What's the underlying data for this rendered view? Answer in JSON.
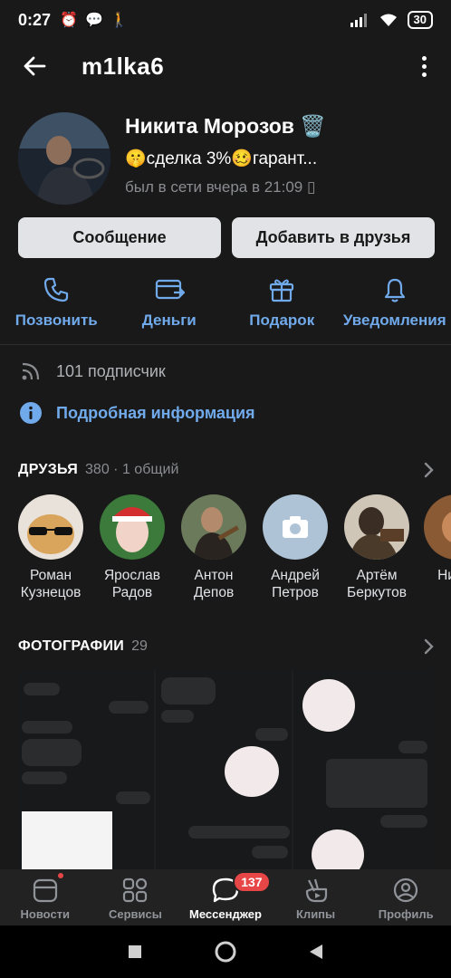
{
  "statusbar": {
    "time": "0:27",
    "battery": "30"
  },
  "header": {
    "username": "m1lka6"
  },
  "profile": {
    "name": "Никита Морозов",
    "status": "🤫сделка 3%🥴гарант...",
    "last_seen": "был в сети вчера в 21:09"
  },
  "buttons": {
    "message": "Сообщение",
    "add_friend": "Добавить в друзья"
  },
  "actions": [
    {
      "label": "Позвонить",
      "icon": "phone-icon"
    },
    {
      "label": "Деньги",
      "icon": "money-transfer-icon"
    },
    {
      "label": "Подарок",
      "icon": "gift-icon"
    },
    {
      "label": "Уведомления",
      "icon": "bell-icon"
    }
  ],
  "info": {
    "followers": "101 подписчик",
    "details": "Подробная информация"
  },
  "friends": {
    "title": "ДРУЗЬЯ",
    "count": "380 · 1 общий",
    "items": [
      {
        "name": "Роман Кузнецов"
      },
      {
        "name": "Ярослав Радов"
      },
      {
        "name": "Антон Депов"
      },
      {
        "name": "Андрей Петров"
      },
      {
        "name": "Артём Беркутов"
      },
      {
        "name": "Ни Кр"
      }
    ]
  },
  "photos": {
    "title": "ФОТОГРАФИИ",
    "count": "29"
  },
  "bottomnav": {
    "items": [
      {
        "label": "Новости"
      },
      {
        "label": "Сервисы"
      },
      {
        "label": "Мессенджер",
        "badge": "137"
      },
      {
        "label": "Клипы"
      },
      {
        "label": "Профиль"
      }
    ]
  },
  "colors": {
    "background": "#19191a",
    "accent": "#71aaeb",
    "badge": "#e64646",
    "button": "#e1e3e6"
  }
}
